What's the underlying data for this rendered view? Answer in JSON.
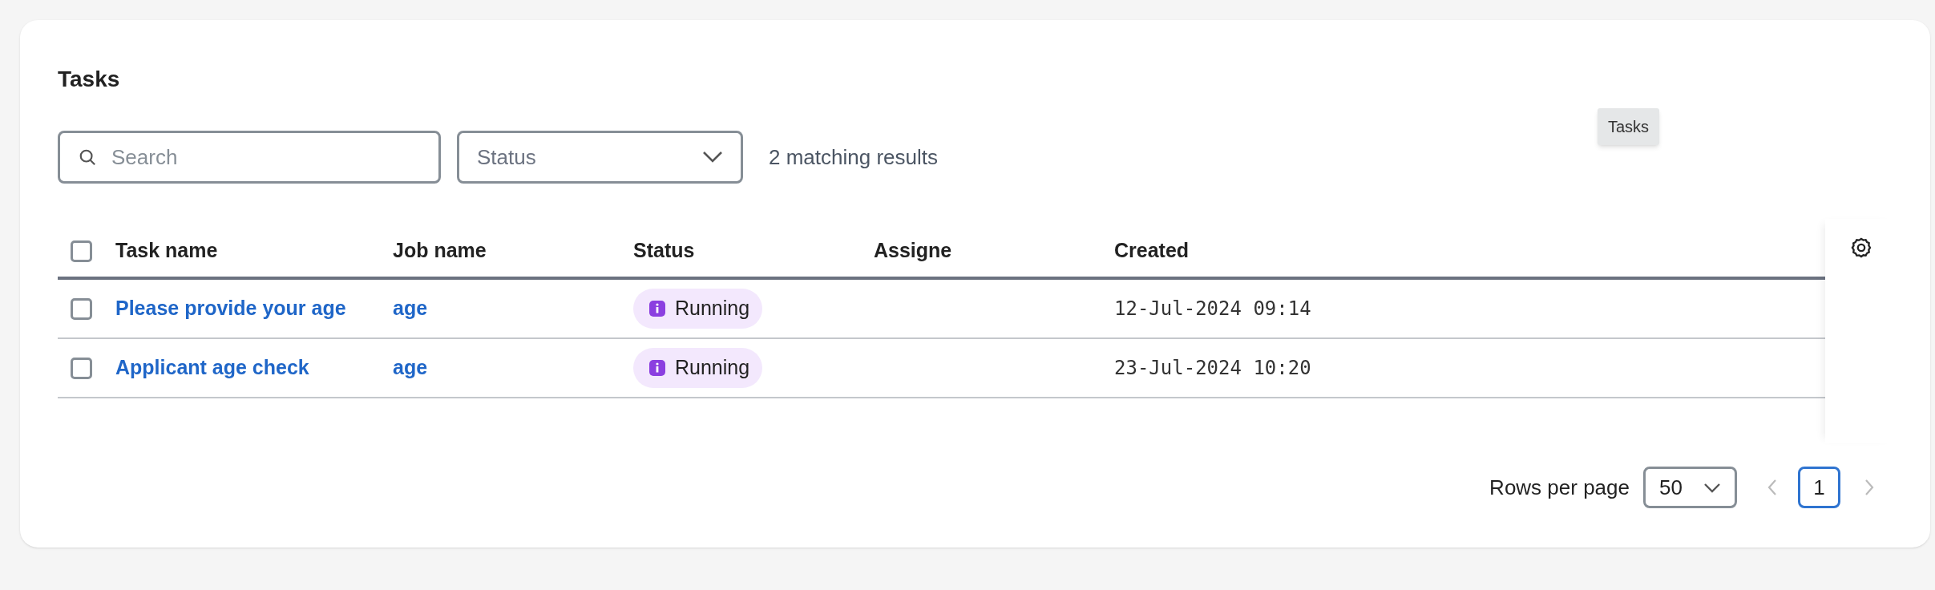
{
  "title": "Tasks",
  "search": {
    "placeholder": "Search"
  },
  "status_filter": {
    "placeholder": "Status"
  },
  "result_count": "2 matching results",
  "tooltip": "Tasks",
  "table": {
    "select_all": {
      "checked": false
    },
    "columns": [
      "Task name",
      "Job name",
      "Status",
      "Assigne",
      "Created"
    ],
    "rows": [
      {
        "checked": false,
        "task_name": "Please provide your age",
        "job_name": "age",
        "status": "Running",
        "created": "12-Jul-2024 09:14"
      },
      {
        "checked": false,
        "task_name": "Applicant age check",
        "job_name": "age",
        "status": "Running",
        "created": "23-Jul-2024 10:20"
      }
    ]
  },
  "pagination": {
    "rows_per_page_label": "Rows per page",
    "rows_per_page": "50",
    "pages": [
      {
        "label": "1",
        "selected": true
      }
    ]
  }
}
